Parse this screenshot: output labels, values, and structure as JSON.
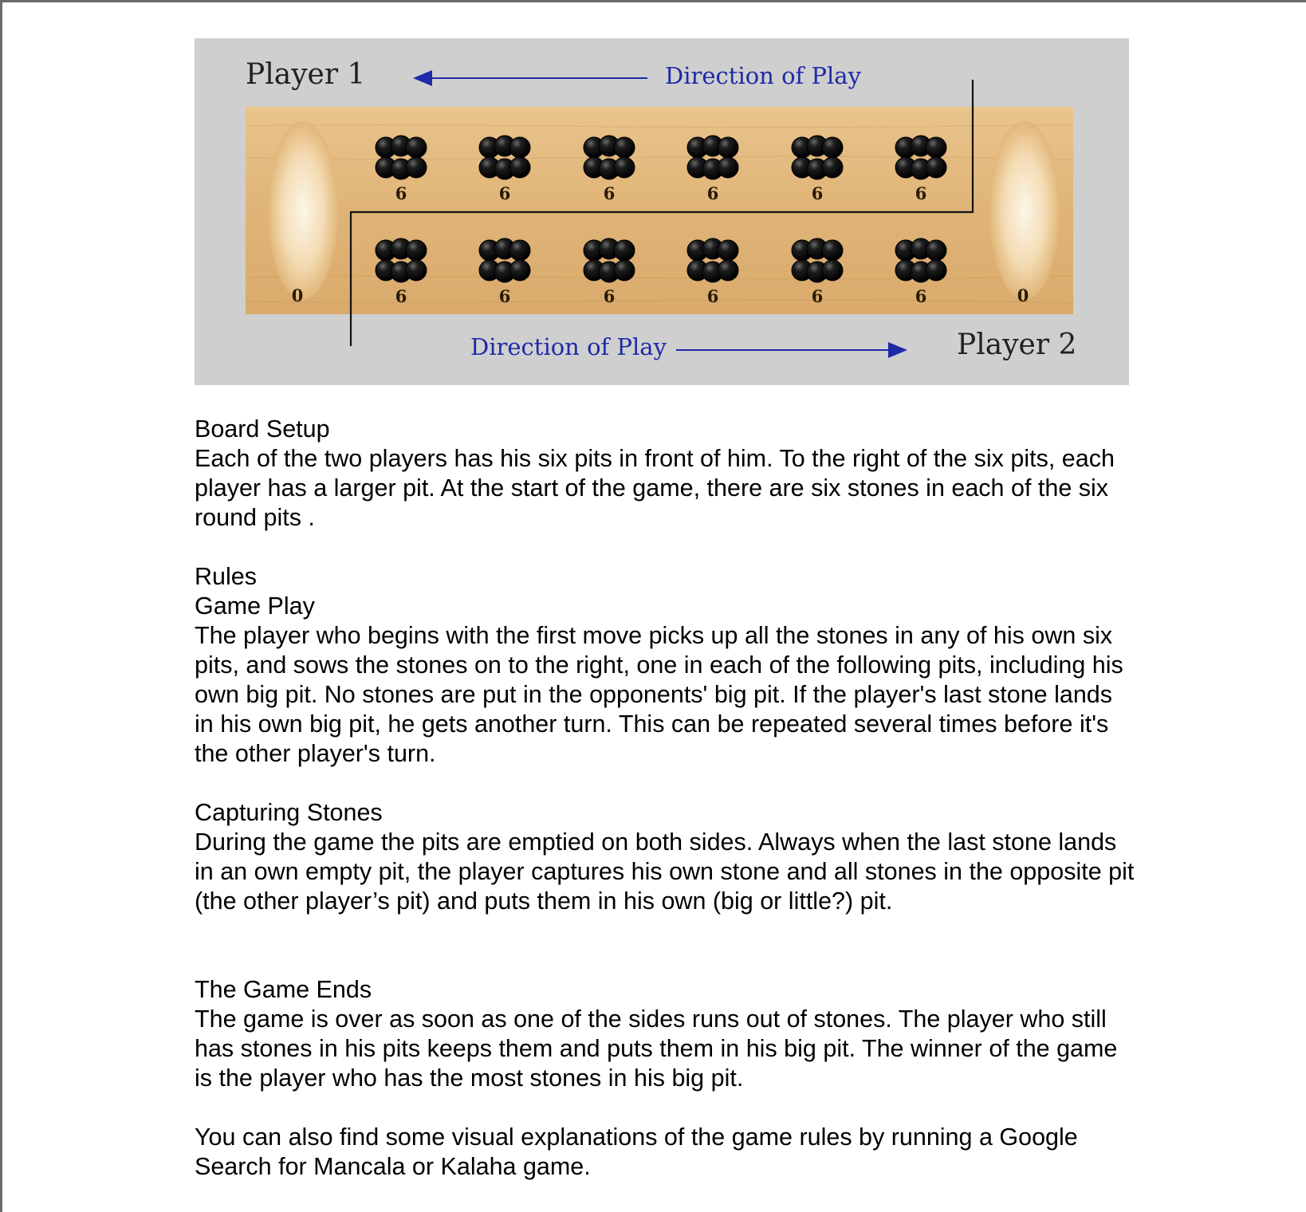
{
  "board": {
    "player1_label": "Player 1",
    "player2_label": "Player 2",
    "direction_top": "Direction of Play",
    "direction_bottom": "Direction of Play",
    "store_left": "0",
    "store_right": "0",
    "top_pits": [
      "6",
      "6",
      "6",
      "6",
      "6",
      "6"
    ],
    "bottom_pits": [
      "6",
      "6",
      "6",
      "6",
      "6",
      "6"
    ],
    "colors": {
      "background": "#cfcfcf",
      "wood": "#e2b679",
      "stones": "#111111",
      "arrow": "#1f2aa8"
    }
  },
  "doc": {
    "board_setup_heading": "Board Setup",
    "board_setup_text": "Each of the two players has his six pits in front of him. To the right of the six pits, each player has a larger pit. At the start of the game, there are six stones in each of the six round pits .",
    "rules_heading": "Rules",
    "game_play_heading": "Game Play",
    "game_play_text": "The player who begins with the first move picks up all the stones in any of his own six pits, and sows the stones on to the right, one in each of the following pits, including his own big pit. No stones are put in the opponents' big pit. If the player's last stone lands in his own big pit, he gets another turn. This can be repeated several times before it's the other player's turn.",
    "capturing_heading": "Capturing Stones",
    "capturing_text": "During the game the pits are emptied on both sides. Always when the last stone lands in an own empty pit, the player captures his own stone and all stones in the opposite pit (the other player’s pit) and puts them in his own (big or little?) pit.",
    "game_ends_heading": "The Game Ends",
    "game_ends_text": "The game is over as soon as one of the sides runs out of stones. The player who still has stones in his pits keeps them and puts them in his big pit. The winner of the game is the player who has the most stones in his big pit.",
    "closing_text": "You can also find some visual explanations of the game rules by running a Google Search for Mancala or Kalaha game."
  }
}
